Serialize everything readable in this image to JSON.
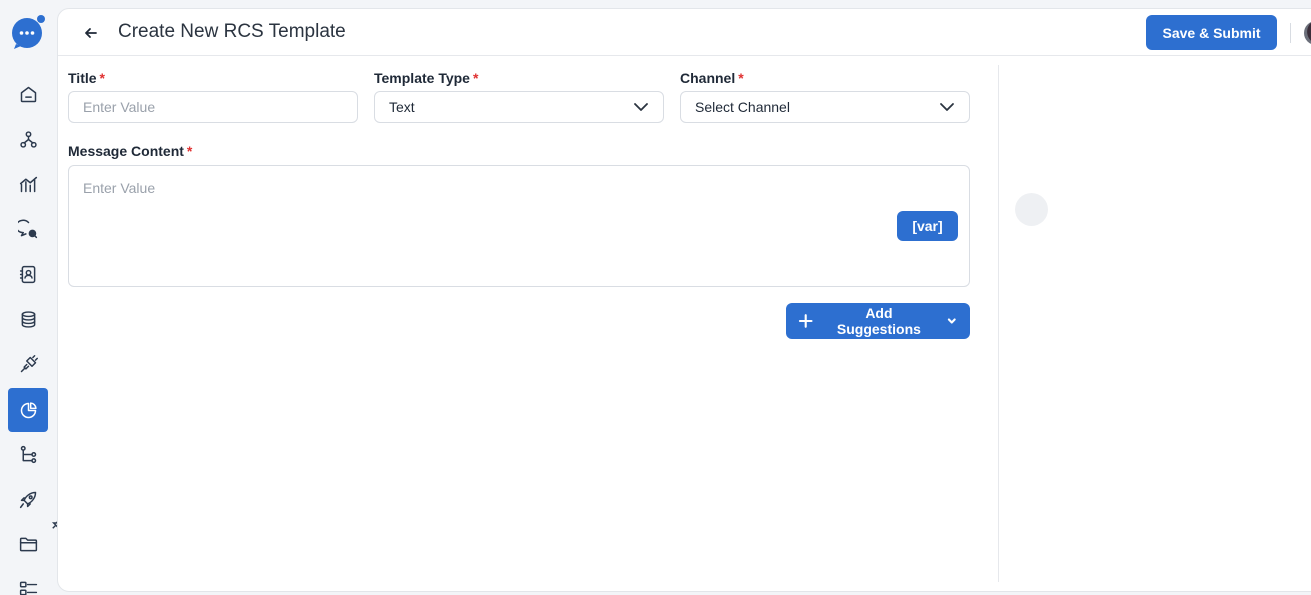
{
  "app": {
    "brand_color": "#2d6fd0"
  },
  "sidebar": {
    "items": [
      {
        "icon": "home-icon",
        "active": false
      },
      {
        "icon": "network-icon",
        "active": false
      },
      {
        "icon": "analytics-icon",
        "active": false
      },
      {
        "icon": "chat-search-icon",
        "active": false
      },
      {
        "icon": "contacts-icon",
        "active": false
      },
      {
        "icon": "database-icon",
        "active": false
      },
      {
        "icon": "plug-icon",
        "active": false
      },
      {
        "icon": "pie-chart-icon",
        "active": true
      },
      {
        "icon": "flow-icon",
        "active": false
      },
      {
        "icon": "rocket-icon",
        "active": false
      },
      {
        "icon": "folder-icon",
        "active": false
      },
      {
        "icon": "settings-list-icon",
        "active": false
      }
    ]
  },
  "header": {
    "title": "Create New RCS Template",
    "save_label": "Save & Submit"
  },
  "form": {
    "title": {
      "label": "Title",
      "required_mark": "*",
      "placeholder": "Enter Value",
      "value": ""
    },
    "template_type": {
      "label": "Template Type",
      "required_mark": "*",
      "value": "Text"
    },
    "channel": {
      "label": "Channel",
      "required_mark": "*",
      "placeholder": "Select Channel"
    },
    "message": {
      "label": "Message Content",
      "required_mark": "*",
      "placeholder": "Enter Value",
      "var_label": "[var]"
    },
    "add_suggestions_label": "Add Suggestions"
  }
}
